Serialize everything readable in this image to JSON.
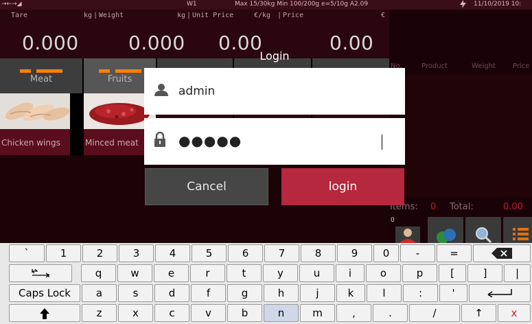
{
  "status_bar": {
    "indicators": "→←→◢",
    "scale_id": "W1",
    "scale_info": "Max 15/30kg  Min 100/200g e=5/10g A2.09",
    "power_icon": "lightning-icon",
    "datetime": "11/10/2019 10:"
  },
  "scale_display": {
    "tare_label": "Tare",
    "tare_unit": "kg",
    "tare_value": "0.000",
    "weight_label": "Weight",
    "weight_unit": "kg",
    "weight_value": "0.000",
    "unit_price_label": "Unit Price",
    "unit_price_unit": "€/kg",
    "unit_price_value": "0.00",
    "price_label": "Price",
    "price_unit": "€",
    "price_value": "0.00"
  },
  "categories": [
    {
      "label": "Meat"
    },
    {
      "label": "Fruits"
    },
    {
      "label": ""
    },
    {
      "label": ""
    },
    {
      "label": ""
    }
  ],
  "products": [
    {
      "label": "Chicken wings"
    },
    {
      "label": "Minced meat"
    }
  ],
  "right_panel": {
    "columns": [
      "No.",
      "Product",
      "Weight",
      "Price"
    ],
    "items_label": "Items:",
    "items_value": "0",
    "total_label": "Total:",
    "total_value": "0.00",
    "counter": "0",
    "buttons": [
      {
        "icon": "customer-icon"
      },
      {
        "icon": "customers-icon"
      },
      {
        "icon": "search-icon"
      },
      {
        "icon": "list-icon"
      }
    ]
  },
  "login_dialog": {
    "title": "Login",
    "username_icon": "user-icon",
    "username_value": "admin",
    "password_icon": "lock-icon",
    "password_value": "●●●●●",
    "cancel_label": "Cancel",
    "login_label": "login"
  },
  "keyboard": {
    "row1": [
      "`",
      "1",
      "2",
      "3",
      "4",
      "5",
      "6",
      "7",
      "8",
      "9",
      "0",
      "-",
      "=",
      "backspace-icon"
    ],
    "row2": [
      "tab-icon",
      "q",
      "w",
      "e",
      "r",
      "t",
      "y",
      "u",
      "i",
      "o",
      "p",
      "[",
      "]",
      "|"
    ],
    "row3": [
      "Caps Lock",
      "a",
      "s",
      "d",
      "f",
      "g",
      "h",
      "j",
      "k",
      "l",
      ":",
      "'",
      "enter-icon"
    ],
    "row4": [
      "shift-icon",
      "z",
      "x",
      "c",
      "v",
      "b",
      "n",
      "m",
      ",",
      ".",
      "/",
      "↑",
      "x"
    ]
  },
  "colors": {
    "accent_red": "#b6283e",
    "category_marker": "#ff8000",
    "background_dark": "#2a0610"
  }
}
